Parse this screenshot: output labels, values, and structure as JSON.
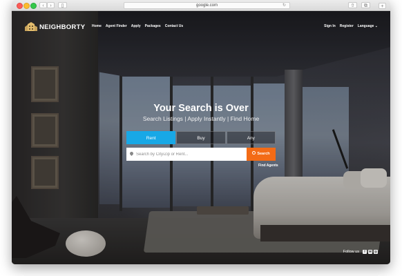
{
  "browser": {
    "address": "google.com",
    "traffic_lights": [
      "close",
      "minimize",
      "zoom"
    ],
    "icons": {
      "back": "chevron-left-icon",
      "forward": "chevron-right-icon",
      "sidebar": "sidebar-icon",
      "reload": "reload-icon",
      "share": "share-icon",
      "tabs": "tabs-icon",
      "new_tab": "plus-icon"
    },
    "glyphs": {
      "back": "‹",
      "forward": "›",
      "sidebar": "▯",
      "reload": "↻",
      "share": "⇧",
      "tabs": "⧉",
      "new_tab": "+"
    }
  },
  "header": {
    "logo_text": "NEIGHBORTY",
    "nav": [
      "Home",
      "Agent Finder",
      "Apply",
      "Packages",
      "Contact Us"
    ],
    "nav_right": [
      "Sign In",
      "Register",
      "Language ⌄"
    ]
  },
  "hero": {
    "headline": "Your Search is Over",
    "subline": "Search Listings | Apply Instantly | Find Home"
  },
  "search": {
    "tabs": [
      "Rent",
      "Buy",
      "Any"
    ],
    "active_tab": "Rent",
    "placeholder": "Search by City/Zip or Rent...",
    "value": "",
    "button_label": "Search",
    "find_agents": "Find Agents"
  },
  "footer": {
    "follow_label": "Follow us",
    "social_icons": [
      "facebook-icon",
      "email-icon",
      "instagram-icon"
    ],
    "social_glyphs": [
      "f",
      "✉",
      "◎"
    ]
  },
  "colors": {
    "accent_blue": "#18a8e6",
    "search_orange": "#f36b16",
    "text_white": "#ffffff"
  }
}
